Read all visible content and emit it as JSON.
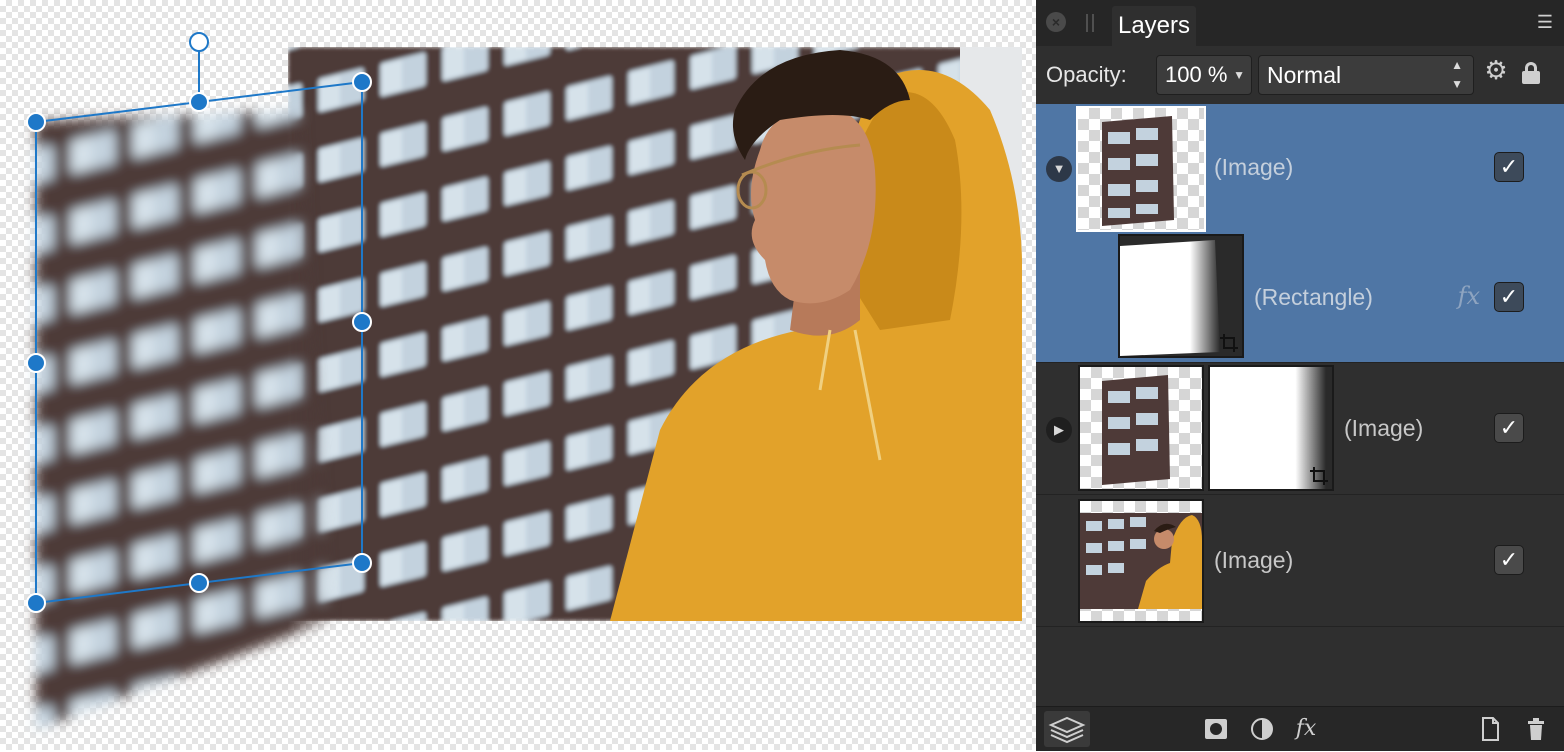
{
  "panel": {
    "tab_title": "Layers",
    "opacity_label": "Opacity:",
    "opacity_value": "100 %",
    "blend_mode": "Normal",
    "icons": {
      "close": "close-icon",
      "menu": "menu-icon",
      "settings": "gear-icon",
      "lock": "lock-icon"
    }
  },
  "layers": [
    {
      "name": "(Image)",
      "selected": true,
      "expanded": true,
      "checked": true,
      "checkmark": "✓"
    },
    {
      "name": "(Rectangle)",
      "selected": true,
      "child": true,
      "fx": "fx",
      "checked": true,
      "checkmark": "✓"
    },
    {
      "name": "(Image)",
      "selected": false,
      "expanded": false,
      "checked": true,
      "checkmark": "✓"
    },
    {
      "name": "(Image)",
      "selected": false,
      "checked": true,
      "checkmark": "✓"
    }
  ],
  "bottom_bar": {
    "fx_label": "fx",
    "icons": [
      "layers-icon",
      "mask-icon",
      "adjustment-icon",
      "fx-icon",
      "new-document-icon",
      "trash-icon"
    ]
  },
  "colors": {
    "selection": "#4f76a5",
    "panel_bg": "#2f2f2f",
    "handle_blue": "#1e78c8",
    "hoodie": "#e2a22a",
    "building": "#4e3a38"
  }
}
